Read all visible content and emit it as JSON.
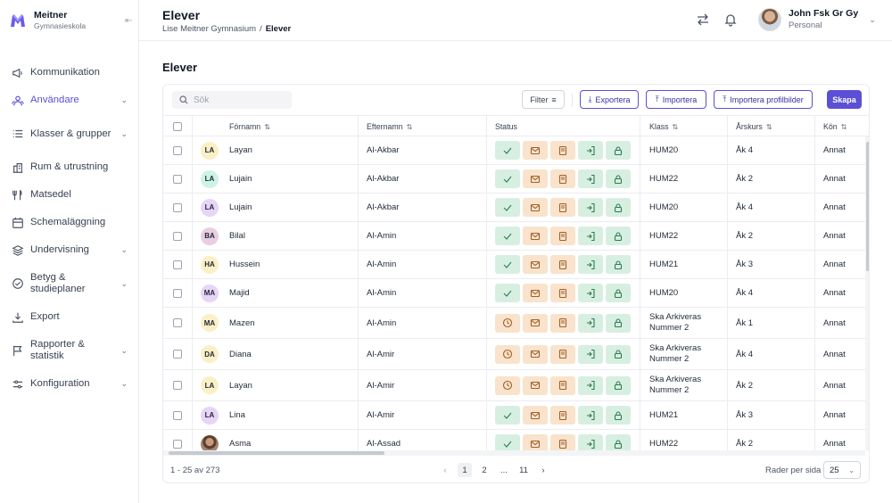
{
  "brand": {
    "name": "Meitner",
    "subtitle": "Gymnasieskola"
  },
  "nav": [
    {
      "label": "Kommunikation",
      "icon": "megaphone-icon",
      "chevron": false,
      "active": false
    },
    {
      "label": "Användare",
      "icon": "users-icon",
      "chevron": true,
      "active": true
    },
    {
      "label": "Klasser & grupper",
      "icon": "list-icon",
      "chevron": true,
      "active": false
    },
    {
      "label": "Rum & utrustning",
      "icon": "building-icon",
      "chevron": false,
      "active": false
    },
    {
      "label": "Matsedel",
      "icon": "utensils-icon",
      "chevron": false,
      "active": false
    },
    {
      "label": "Schemaläggning",
      "icon": "calendar-icon",
      "chevron": false,
      "active": false
    },
    {
      "label": "Undervisning",
      "icon": "layers-icon",
      "chevron": true,
      "active": false
    },
    {
      "label": "Betyg & studieplaner",
      "icon": "check-circle-icon",
      "chevron": true,
      "active": false
    },
    {
      "label": "Export",
      "icon": "download-icon",
      "chevron": false,
      "active": false
    },
    {
      "label": "Rapporter & statistik",
      "icon": "flag-icon",
      "chevron": true,
      "active": false
    },
    {
      "label": "Konfiguration",
      "icon": "sliders-icon",
      "chevron": true,
      "active": false
    }
  ],
  "header": {
    "title": "Elever",
    "breadcrumb": {
      "parent": "Lise Meitner Gymnasium",
      "separator": "/",
      "current": "Elever"
    },
    "user": {
      "name": "John Fsk Gr Gy",
      "role": "Personal"
    }
  },
  "main": {
    "title": "Elever",
    "search_placeholder": "Sök",
    "filter_label": "Filter",
    "export_label": "Exportera",
    "import_label": "Importera",
    "import_photos_label": "Importera profilbilder",
    "create_label": "Skapa"
  },
  "table": {
    "headers": {
      "firstname": "Förnamn",
      "lastname": "Efternamn",
      "status": "Status",
      "klass": "Klass",
      "arskurs": "Årskurs",
      "kon": "Kön"
    },
    "rows": [
      {
        "initials": "LA",
        "avatar_color": "#fbefc6",
        "first": "Layan",
        "last": "Al-Akbar",
        "state": "check",
        "klass": "HUM20",
        "arskurs": "Åk 4",
        "kon": "Annat"
      },
      {
        "initials": "LA",
        "avatar_color": "#cdf3e6",
        "first": "Lujain",
        "last": "Al-Akbar",
        "state": "check",
        "klass": "HUM22",
        "arskurs": "Åk 2",
        "kon": "Annat"
      },
      {
        "initials": "LA",
        "avatar_color": "#e7d4f7",
        "first": "Lujain",
        "last": "Al-Akbar",
        "state": "check",
        "klass": "HUM20",
        "arskurs": "Åk 4",
        "kon": "Annat"
      },
      {
        "initials": "BA",
        "avatar_color": "#e9cde1",
        "first": "Bilal",
        "last": "Al-Amin",
        "state": "check",
        "klass": "HUM22",
        "arskurs": "Åk 2",
        "kon": "Annat"
      },
      {
        "initials": "HA",
        "avatar_color": "#fbefc6",
        "first": "Hussein",
        "last": "Al-Amin",
        "state": "check",
        "klass": "HUM21",
        "arskurs": "Åk 3",
        "kon": "Annat"
      },
      {
        "initials": "MA",
        "avatar_color": "#e7d4f7",
        "first": "Majid",
        "last": "Al-Amin",
        "state": "check",
        "klass": "HUM20",
        "arskurs": "Åk 4",
        "kon": "Annat"
      },
      {
        "initials": "MA",
        "avatar_color": "#fbefc6",
        "first": "Mazen",
        "last": "Al-Amin",
        "state": "clock",
        "klass": "Ska Arkiveras Nummer 2",
        "arskurs": "Åk 1",
        "kon": "Annat"
      },
      {
        "initials": "DA",
        "avatar_color": "#fbefc6",
        "first": "Diana",
        "last": "Al-Amir",
        "state": "clock",
        "klass": "Ska Arkiveras Nummer 2",
        "arskurs": "Åk 4",
        "kon": "Annat"
      },
      {
        "initials": "LA",
        "avatar_color": "#fbefc6",
        "first": "Layan",
        "last": "Al-Amir",
        "state": "clock",
        "klass": "Ska Arkiveras Nummer 2",
        "arskurs": "Åk 2",
        "kon": "Annat"
      },
      {
        "initials": "LA",
        "avatar_color": "#e7d4f7",
        "first": "Lina",
        "last": "Al-Amir",
        "state": "check",
        "klass": "HUM21",
        "arskurs": "Åk 3",
        "kon": "Annat"
      },
      {
        "initials": "",
        "avatar_color": "#8a6a55",
        "photo": true,
        "first": "Asma",
        "last": "Al-Assad",
        "state": "check",
        "klass": "HUM22",
        "arskurs": "Åk 2",
        "kon": "Annat"
      }
    ]
  },
  "footer": {
    "range": "1 - 25 av 273",
    "pages": [
      "1",
      "2",
      "...",
      "11"
    ],
    "current_page": "1",
    "rows_per_page_label": "Rader per sida",
    "rows_per_page_value": "25"
  },
  "colors": {
    "accent": "#5b4fd6",
    "status_green": "#d7efe1",
    "status_orange": "#f9e3cc"
  }
}
